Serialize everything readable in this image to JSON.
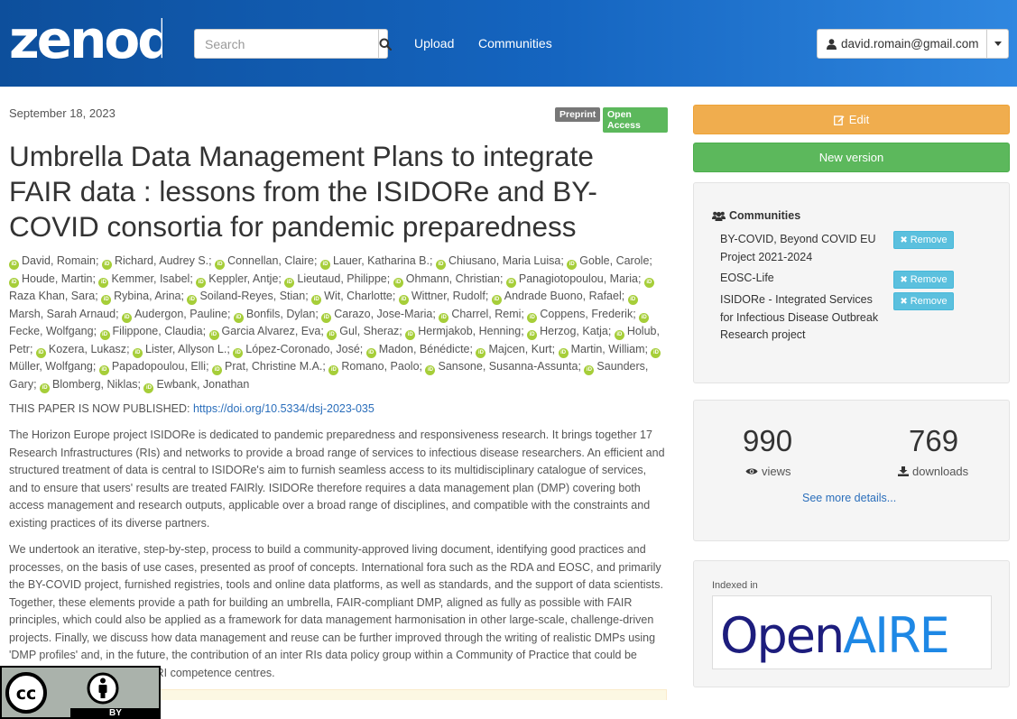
{
  "header": {
    "logo_text": "zenodo",
    "search_placeholder": "Search",
    "nav": [
      {
        "label": "Upload"
      },
      {
        "label": "Communities"
      }
    ],
    "user_email": "david.romain@gmail.com"
  },
  "record": {
    "date": "September 18, 2023",
    "labels": {
      "type": "Preprint",
      "access": "Open Access"
    },
    "title": "Umbrella Data Management Plans to integrate FAIR data : lessons from the ISIDORe and BY-COVID consortia for pandemic preparedness",
    "authors": [
      "David, Romain",
      "Richard, Audrey S.",
      "Connellan, Claire",
      "Lauer, Katharina B.",
      "Chiusano, Maria Luisa",
      "Goble, Carole",
      "Houde, Martin",
      "Kemmer, Isabel",
      "Keppler, Antje",
      "Lieutaud, Philippe",
      "Ohmann, Christian",
      "Panagiotopoulou, Maria",
      "Raza Khan, Sara",
      "Rybina, Arina",
      "Soiland-Reyes, Stian",
      "Wit, Charlotte",
      "Wittner, Rudolf",
      "Andrade Buono, Rafael",
      "Marsh, Sarah Arnaud",
      "Audergon, Pauline",
      "Bonfils, Dylan",
      "Carazo, Jose-Maria",
      "Charrel, Remi",
      "Coppens, Frederik",
      "Fecke, Wolfgang",
      "Filippone, Claudia",
      "Garcia Alvarez, Eva",
      "Gul, Sheraz",
      "Hermjakob, Henning",
      "Herzog, Katja",
      "Holub, Petr",
      "Kozera, Lukasz",
      "Lister, Allyson L.",
      "López-Coronado, José",
      "Madon, Bénédicte",
      "Majcen, Kurt",
      "Martin, William",
      "Müller, Wolfgang",
      "Papadopoulou, Elli",
      "Prat, Christine M.A.",
      "Romano, Paolo",
      "Sansone, Susanna-Assunta",
      "Saunders, Gary",
      "Blomberg, Niklas",
      "Ewbank, Jonathan"
    ],
    "published_prefix": "THIS PAPER IS NOW PUBLISHED: ",
    "published_link": "https://doi.org/10.5334/dsj-2023-035",
    "abstract_p1": "The Horizon Europe project ISIDORe is dedicated to pandemic preparedness and responsiveness research. It brings together 17 Research Infrastructures (RIs) and networks to provide a broad range of services to infectious disease researchers. An efficient and structured treatment of data is central to ISIDORe's aim to furnish seamless access to its multidisciplinary catalogue of services, and to ensure that users' results are treated FAIRly. ISIDORe therefore requires a data management plan (DMP) covering both access management and research outputs, applicable over a broad range of disciplines, and compatible with the constraints and existing practices of its diverse partners.",
    "abstract_p2": "We undertook an iterative, step-by-step, process to build a community-approved living document, identifying good practices and processes, on the basis of use cases, presented as proof of concepts. International fora such as the RDA and EOSC, and primarily the BY-COVID project, furnished registries, tools and online data platforms, as well as standards, and the support of data scientists. Together, these elements provide a path for building an umbrella, FAIR-compliant DMP, aligned as fully as possible with FAIR principles, which could also be applied as a framework for data management harmonisation in other large-scale, challenge-driven projects. Finally, we discuss how data management and reuse can be further improved through the writing of realistic DMPs using 'DMP profiles' and, in the future, the contribution of an inter RIs data policy group within a Community of Practice that could be integrated into planned trans-RI competence centres."
  },
  "license": {
    "cc": "cc",
    "by": "BY"
  },
  "sidebar": {
    "edit_label": "Edit",
    "new_version_label": "New version",
    "communities_heading": "Communities",
    "communities": [
      {
        "name": "BY-COVID, Beyond COVID EU Project 2021-2024",
        "remove": "Remove"
      },
      {
        "name": "EOSC-Life",
        "remove": "Remove"
      },
      {
        "name": "ISIDORe - Integrated Services for Infectious Disease Outbreak Research project",
        "remove": "Remove"
      }
    ],
    "stats": {
      "views": "990",
      "views_label": "views",
      "downloads": "769",
      "downloads_label": "downloads",
      "see_more": "See more details..."
    },
    "indexed_in": "Indexed in",
    "openaire": {
      "part1": "Open",
      "part2": "AIRE"
    }
  },
  "colors": {
    "header_blue": "#1565c0",
    "edit_orange": "#f0ad4e",
    "new_version_green": "#5cb85c",
    "open_access_green": "#5cb85c",
    "remove_blue": "#5bc0de",
    "link_blue": "#2a6ebb",
    "orcid_green": "#a6ce39",
    "openaire_navy": "#1d1d7d",
    "openaire_blue": "#1e88e5"
  }
}
